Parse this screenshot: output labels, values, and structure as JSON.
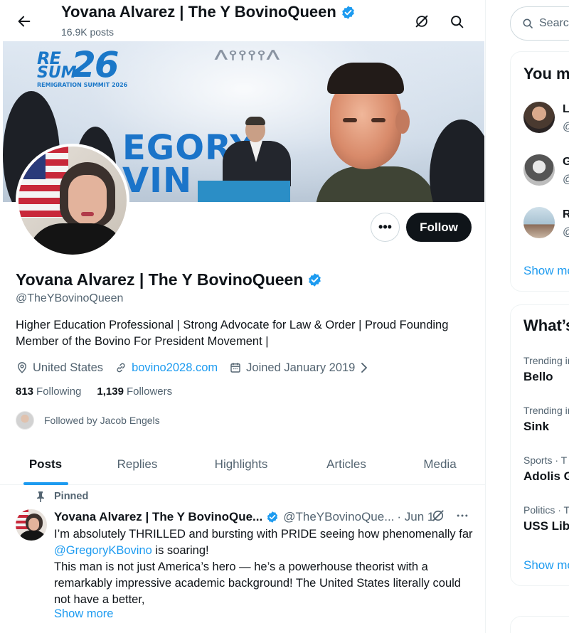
{
  "topbar": {
    "title": "Yovana Alvarez | The Y BovinoQueen",
    "posts_count": "16.9K posts"
  },
  "banner": {
    "logo_re": "RE",
    "logo_num": "26",
    "logo_sm": "SUM",
    "logo_caption": "REMIGRATION SUMMIT 2026",
    "name_line1": "EGORY",
    "name_line2": "VIN"
  },
  "profile": {
    "name": "Yovana Alvarez | The Y BovinoQueen",
    "handle": "@TheYBovinoQueen",
    "bio": "Higher Education Professional | Strong Advocate for Law & Order | Proud Founding Member of the Bovino For President Movement |",
    "location": "United States",
    "website": "bovino2028.com",
    "joined": "Joined January 2019",
    "following_count": "813",
    "following_label": "Following",
    "followers_count": "1,139",
    "followers_label": "Followers",
    "followed_by": "Followed by Jacob Engels",
    "follow_button": "Follow",
    "more_button": "•••"
  },
  "tabs": [
    {
      "label": "Posts",
      "active": true
    },
    {
      "label": "Replies"
    },
    {
      "label": "Highlights"
    },
    {
      "label": "Articles"
    },
    {
      "label": "Media"
    }
  ],
  "post": {
    "pinned_label": "Pinned",
    "author_name": "Yovana Alvarez | The Y BovinoQue...",
    "author_handle": "@TheYBovinoQue...",
    "date": "· Jun 1",
    "text_before": "I’m absolutely THRILLED and bursting with PRIDE seeing how phenomenally far ",
    "mention": "@GregoryKBovino",
    "text_after": " is soaring!",
    "text_para2": "This man is not just America’s hero — he’s a powerhouse theorist with a remarkably impressive academic background! The United States literally could not have a better,",
    "show_more": "Show more"
  },
  "sidebar": {
    "search_placeholder": "Search",
    "who_to_follow": {
      "title": "You might like",
      "items": [
        {
          "name": "L",
          "handle": "@"
        },
        {
          "name": "G",
          "handle": "@"
        },
        {
          "name": "R",
          "handle": "@"
        }
      ],
      "show_more": "Show more"
    },
    "trends": {
      "title": "What’s happening",
      "items": [
        {
          "category": "Trending in",
          "name": "Bello"
        },
        {
          "category": "Trending in",
          "name": "Sink"
        },
        {
          "category": "Sports · T",
          "name": "Adolis G"
        },
        {
          "category": "Politics · T",
          "name": "USS Libe"
        }
      ],
      "show_more": "Show more"
    }
  },
  "colors": {
    "accent": "#1d9bf0",
    "text": "#0f1419",
    "muted": "#536471",
    "border": "#eff3f4"
  }
}
